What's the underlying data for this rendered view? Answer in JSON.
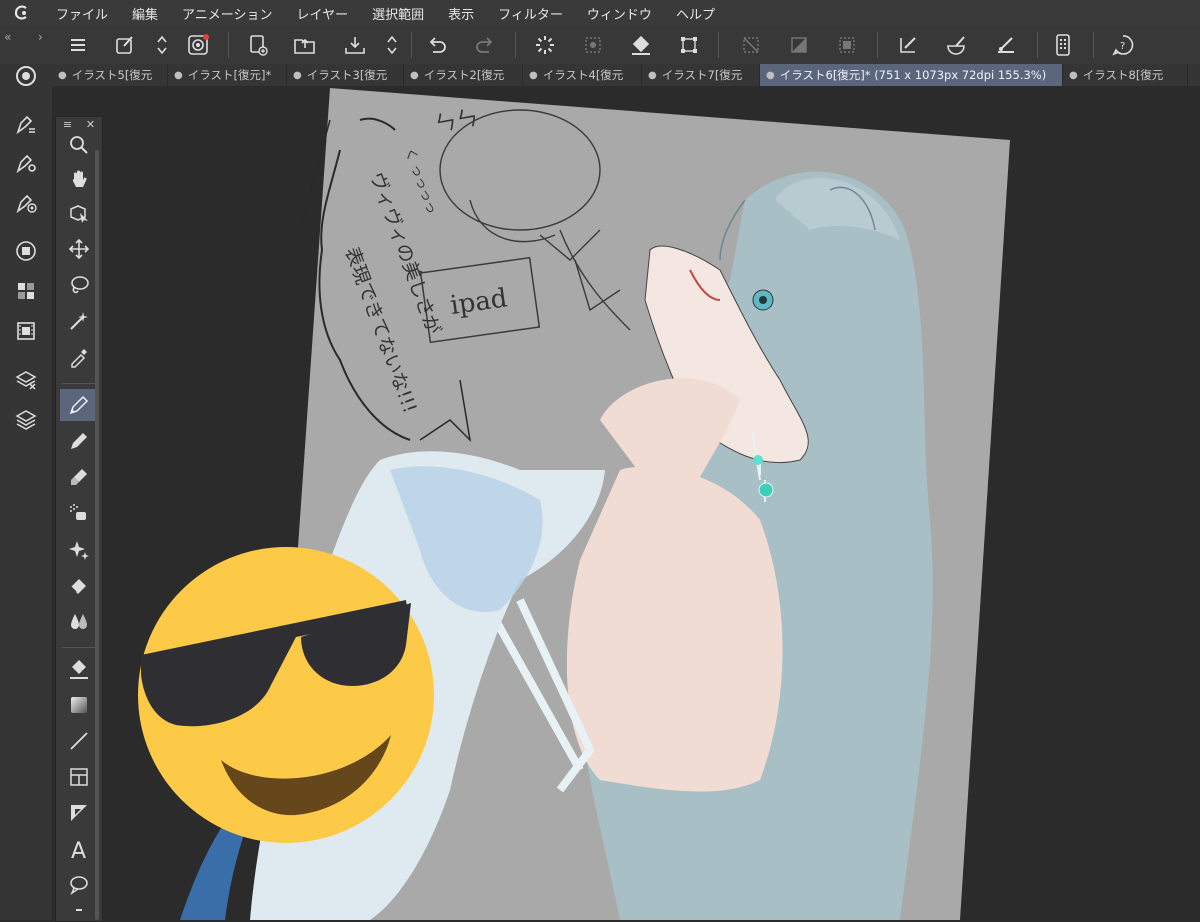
{
  "menu": {
    "items": [
      "ファイル",
      "編集",
      "アニメーション",
      "レイヤー",
      "選択範囲",
      "表示",
      "フィルター",
      "ウィンドウ",
      "ヘルプ"
    ]
  },
  "tabs": [
    {
      "label": "イラスト5[復元"
    },
    {
      "label": "イラスト[復元]*"
    },
    {
      "label": "イラスト3[復元"
    },
    {
      "label": "イラスト2[復元"
    },
    {
      "label": "イラスト4[復元"
    },
    {
      "label": "イラスト7[復元"
    },
    {
      "label": "イラスト6[復元]* (751 x 1073px 72dpi 155.3%)",
      "active": true
    },
    {
      "label": "イラスト8[復元"
    }
  ],
  "artwork": {
    "speech_text": [
      "ヴィヴィの美しさが",
      "表現できてないな!!!"
    ],
    "box_text": "ipad",
    "sfx": "ㄣㄣ",
    "small_text": "く っっっっ"
  },
  "colors": {
    "accent_active": "#5b667d",
    "panel": "#353535",
    "canvas_bg": "#2b2b2b",
    "paper": "#a9a9a9",
    "hair": "#a9bfc6",
    "sticker_face": "#fdca47"
  },
  "icons": {
    "toolbar": [
      "menu-icon",
      "new-layer-icon",
      "updown-icon",
      "spiral-icon",
      "new-file-icon",
      "open-folder-icon",
      "save-icon",
      "updown-icon",
      "undo-icon",
      "redo-icon",
      "loading-icon",
      "select-icon",
      "fill-icon",
      "transform-icon",
      "deselect-icon",
      "invert-icon",
      "selection-box-icon",
      "pen-ruler-icon",
      "brush-icon",
      "ruler-icon",
      "phone-icon",
      "help-icon"
    ],
    "left": [
      "navigator-icon",
      "pen-list-icon",
      "pen-settings-icon",
      "pen-target-icon",
      "layer-panel-icon",
      "grid-icon",
      "film-icon",
      "layers-x-icon",
      "layers-icon"
    ],
    "tools": [
      "zoom-icon",
      "hand-icon",
      "object-icon",
      "move-icon",
      "lasso-icon",
      "magic-wand-icon",
      "eyedropper-icon",
      "pen-icon",
      "pencil-icon",
      "brush-icon",
      "airbrush-icon",
      "sparkle-icon",
      "eraser-icon",
      "blend-icon",
      "fill-icon",
      "gradient-icon",
      "line-icon",
      "frame-icon",
      "ruler-icon",
      "text-icon",
      "balloon-icon"
    ]
  }
}
